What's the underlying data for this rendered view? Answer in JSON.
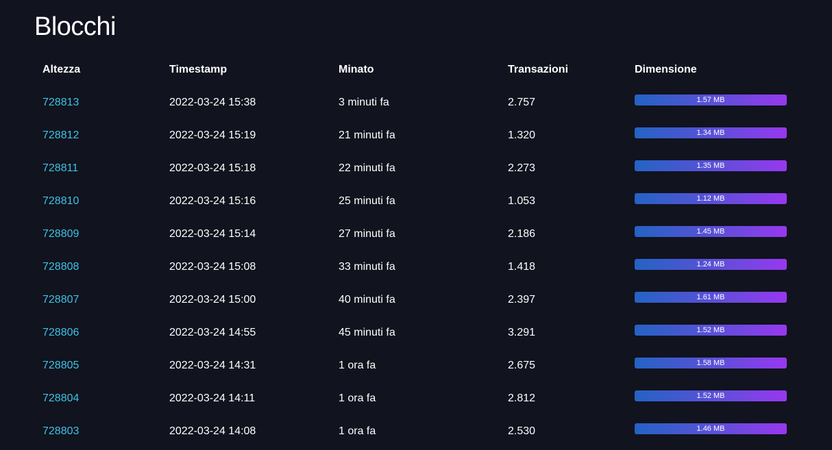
{
  "page": {
    "title": "Blocchi"
  },
  "table": {
    "headers": [
      "Altezza",
      "Timestamp",
      "Minato",
      "Transazioni",
      "Dimensione"
    ],
    "rows": [
      {
        "height": "728813",
        "timestamp": "2022-03-24 15:38",
        "mined": "3 minuti fa",
        "transactions": "2.757",
        "size": "1.57 MB",
        "size_fill": 1.0
      },
      {
        "height": "728812",
        "timestamp": "2022-03-24 15:19",
        "mined": "21 minuti fa",
        "transactions": "1.320",
        "size": "1.34 MB",
        "size_fill": 1.0
      },
      {
        "height": "728811",
        "timestamp": "2022-03-24 15:18",
        "mined": "22 minuti fa",
        "transactions": "2.273",
        "size": "1.35 MB",
        "size_fill": 1.0
      },
      {
        "height": "728810",
        "timestamp": "2022-03-24 15:16",
        "mined": "25 minuti fa",
        "transactions": "1.053",
        "size": "1.12 MB",
        "size_fill": 1.0
      },
      {
        "height": "728809",
        "timestamp": "2022-03-24 15:14",
        "mined": "27 minuti fa",
        "transactions": "2.186",
        "size": "1.45 MB",
        "size_fill": 1.0
      },
      {
        "height": "728808",
        "timestamp": "2022-03-24 15:08",
        "mined": "33 minuti fa",
        "transactions": "1.418",
        "size": "1.24 MB",
        "size_fill": 1.0
      },
      {
        "height": "728807",
        "timestamp": "2022-03-24 15:00",
        "mined": "40 minuti fa",
        "transactions": "2.397",
        "size": "1.61 MB",
        "size_fill": 1.0
      },
      {
        "height": "728806",
        "timestamp": "2022-03-24 14:55",
        "mined": "45 minuti fa",
        "transactions": "3.291",
        "size": "1.52 MB",
        "size_fill": 1.0
      },
      {
        "height": "728805",
        "timestamp": "2022-03-24 14:31",
        "mined": "1 ora fa",
        "transactions": "2.675",
        "size": "1.58 MB",
        "size_fill": 1.0
      },
      {
        "height": "728804",
        "timestamp": "2022-03-24 14:11",
        "mined": "1 ora fa",
        "transactions": "2.812",
        "size": "1.52 MB",
        "size_fill": 1.0
      },
      {
        "height": "728803",
        "timestamp": "2022-03-24 14:08",
        "mined": "1 ora fa",
        "transactions": "2.530",
        "size": "1.46 MB",
        "size_fill": 1.0
      }
    ]
  },
  "colors": {
    "background": "#11131e",
    "link": "#3cc3e6",
    "bar_start": "#2463c4",
    "bar_end": "#9838f0"
  }
}
